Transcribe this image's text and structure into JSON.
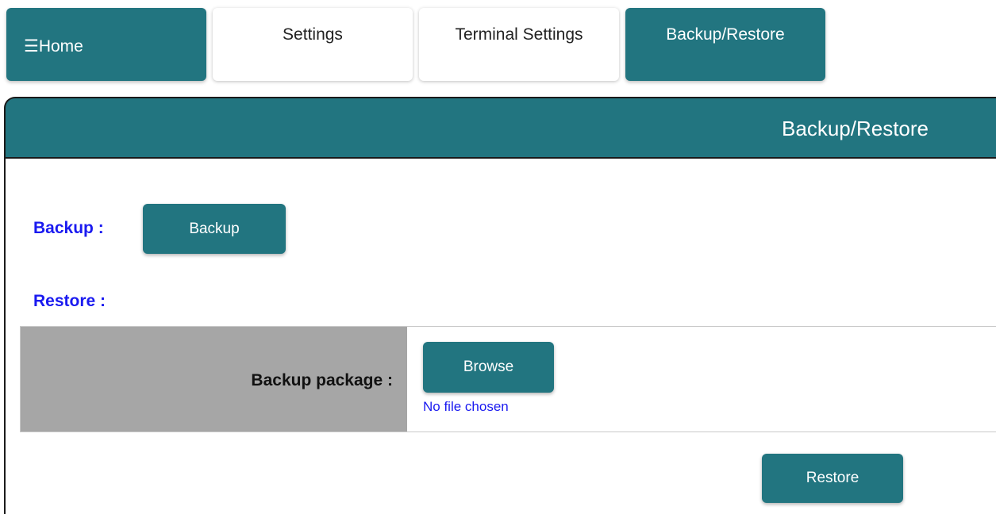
{
  "tabs": {
    "home": "☰Home",
    "settings": "Settings",
    "terminal_settings": "Terminal Settings",
    "backup_restore": "Backup/Restore"
  },
  "panel": {
    "title": "Backup/Restore"
  },
  "backup": {
    "label": "Backup :",
    "button": "Backup"
  },
  "restore": {
    "label": "Restore :",
    "package_label": "Backup package :",
    "browse_button": "Browse",
    "file_status": "No file chosen",
    "restore_button": "Restore"
  },
  "colors": {
    "accent": "#227580",
    "label_blue": "#1a1af0",
    "label_cell": "#a6a6a6"
  }
}
